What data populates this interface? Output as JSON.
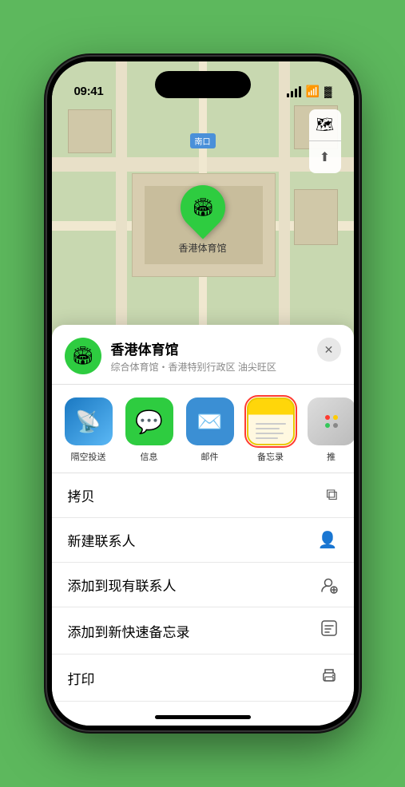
{
  "statusBar": {
    "time": "09:41",
    "locationArrow": "▲"
  },
  "map": {
    "label": "南口",
    "pin": {
      "emoji": "🏟",
      "label": "香港体育馆"
    },
    "controls": {
      "mapIcon": "🗺",
      "locationIcon": "➤"
    }
  },
  "bottomSheet": {
    "location": {
      "name": "香港体育馆",
      "subtitle": "综合体育馆・香港特别行政区 油尖旺区",
      "iconEmoji": "🏟",
      "closeLabel": "✕"
    },
    "shareApps": [
      {
        "id": "airdrop",
        "label": "隔空投送",
        "type": "airdrop"
      },
      {
        "id": "messages",
        "label": "信息",
        "type": "messages"
      },
      {
        "id": "mail",
        "label": "邮件",
        "type": "mail"
      },
      {
        "id": "notes",
        "label": "备忘录",
        "type": "notes",
        "selected": true
      },
      {
        "id": "more",
        "label": "推",
        "type": "more"
      }
    ],
    "actions": [
      {
        "id": "copy",
        "label": "拷贝",
        "icon": "⎘"
      },
      {
        "id": "new-contact",
        "label": "新建联系人",
        "icon": "👤"
      },
      {
        "id": "add-existing",
        "label": "添加到现有联系人",
        "icon": "👤"
      },
      {
        "id": "add-note",
        "label": "添加到新快速备忘录",
        "icon": "📋"
      },
      {
        "id": "print",
        "label": "打印",
        "icon": "🖨"
      }
    ]
  },
  "homeIndicator": ""
}
